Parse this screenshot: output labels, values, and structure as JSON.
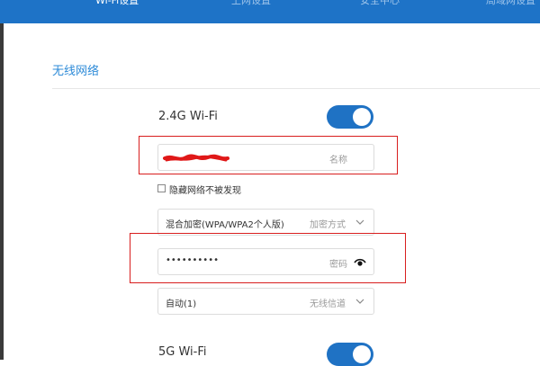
{
  "nav": {
    "tabs": [
      {
        "label": "Wi-Fi设置",
        "active": true
      },
      {
        "label": "上网设置",
        "active": false
      },
      {
        "label": "安全中心",
        "active": false
      },
      {
        "label": "局域网设置",
        "active": false
      }
    ]
  },
  "section": {
    "title": "无线网络"
  },
  "wifi24": {
    "label": "2.4G Wi-Fi",
    "enabled": true,
    "name_hint": "名称",
    "hide_network_label": "隐藏网络不被发现",
    "hide_network_checked": false,
    "encryption_value": "混合加密(WPA/WPA2个人版)",
    "encryption_hint": "加密方式",
    "password_value": "••••••••••",
    "password_hint": "密码",
    "channel_value": "自动(1)",
    "channel_hint": "无线信道"
  },
  "wifi5": {
    "label": "5G Wi-Fi",
    "enabled": true
  },
  "colors": {
    "nav_bg": "#1e73c7",
    "accent": "#2e8bd8",
    "toggle_on": "#1f72c4",
    "highlight_red": "#d81e1e"
  }
}
